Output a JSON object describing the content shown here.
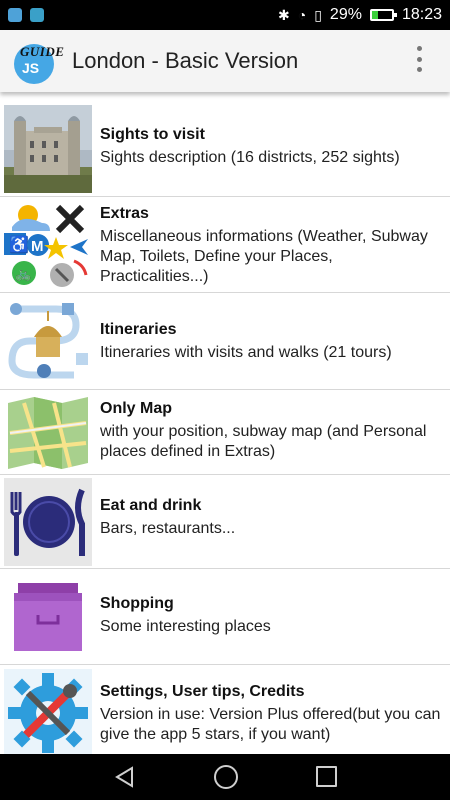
{
  "status_bar": {
    "battery_percent": "29%",
    "battery_level": 0.29,
    "time": "18:23"
  },
  "app_bar": {
    "logo_top": "GUIDE",
    "logo_bottom": "JS",
    "title": "London - Basic Version",
    "menu_icon": "overflow-menu-icon"
  },
  "items": [
    {
      "title": "Sights to visit",
      "description": "Sights description (16 districts, 252 sights)",
      "icon": "tower-photo"
    },
    {
      "title": "Extras",
      "description": "Miscellaneous informations (Weather, Subway Map, Toilets, Define your Places, Practicalities...)",
      "icon": "extras-collage"
    },
    {
      "title": "Itineraries",
      "description": "Itineraries with visits and walks (21 tours)",
      "icon": "itinerary-path"
    },
    {
      "title": "Only Map",
      "description": "with your position, subway map (and Personal places defined in Extras)",
      "icon": "folded-map"
    },
    {
      "title": "Eat and drink",
      "description": "Bars, restaurants...",
      "icon": "fork-knife-plate"
    },
    {
      "title": "Shopping",
      "description": "Some interesting places",
      "icon": "shopping-box"
    },
    {
      "title": "Settings, User tips, Credits",
      "description": "Version in use: Version Plus offered(but you can give the app 5 stars, if you want)",
      "icon": "settings-gear-tools"
    }
  ],
  "colors": {
    "logo_blue": "#45a7e5",
    "app_bar_bg": "#f4f4f4",
    "battery_green": "#3bd13b"
  }
}
